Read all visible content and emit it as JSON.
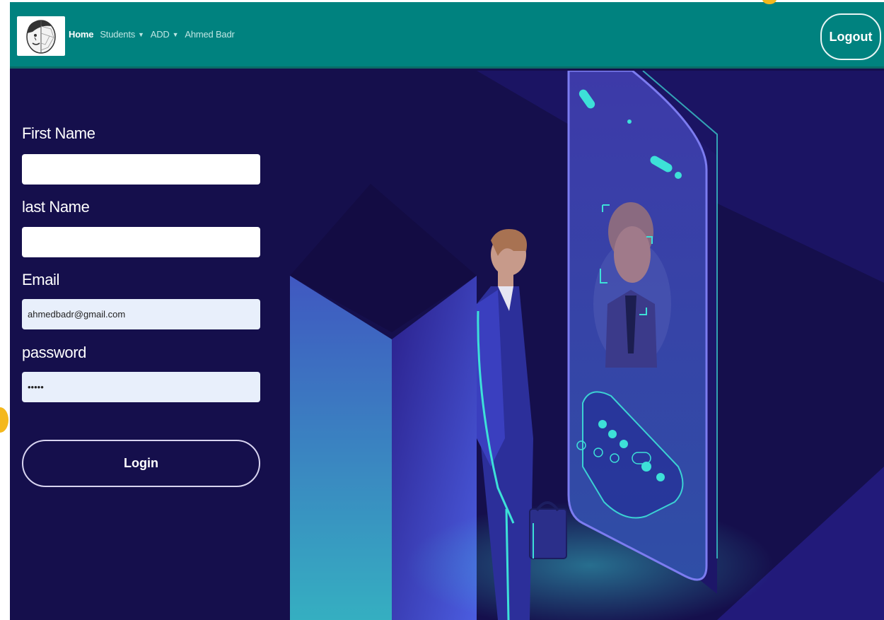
{
  "navbar": {
    "links": [
      {
        "label": "Home",
        "active": true,
        "dropdown": false
      },
      {
        "label": "Students",
        "active": false,
        "dropdown": true
      },
      {
        "label": "ADD",
        "active": false,
        "dropdown": true
      },
      {
        "label": "Ahmed Badr",
        "active": false,
        "dropdown": false
      }
    ],
    "logout_label": "Logout"
  },
  "form": {
    "first_name": {
      "label": "First Name",
      "value": ""
    },
    "last_name": {
      "label": "last Name",
      "value": ""
    },
    "email": {
      "label": "Email",
      "value": "ahmedbadr@gmail.com"
    },
    "password": {
      "label": "password",
      "value": "•••••"
    },
    "login_label": "Login"
  },
  "colors": {
    "navbar": "#00827f",
    "background": "#150f4c",
    "accent": "#3de0d8",
    "badge": "#f4b81c"
  }
}
